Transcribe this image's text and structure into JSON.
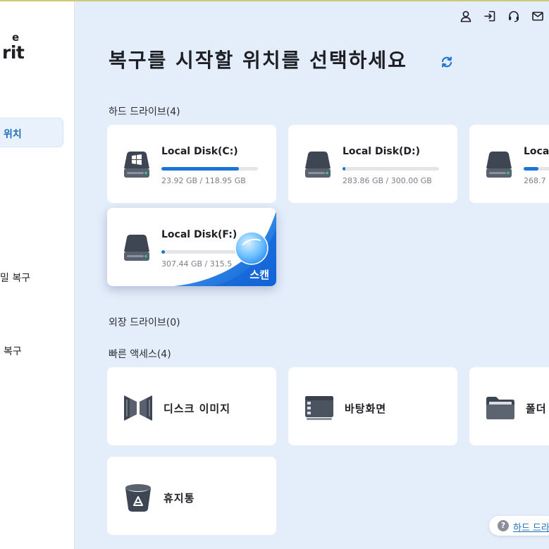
{
  "brand": {
    "logo_small": "e",
    "logo_large": "rit"
  },
  "sidebar": {
    "items": [
      {
        "label": "위치",
        "active": true
      },
      {
        "label": "밀 복구",
        "active": false
      },
      {
        "label": "복구",
        "active": false
      }
    ]
  },
  "topbar": {
    "icons": [
      "user-icon",
      "sign-in-icon",
      "headset-icon",
      "mail-icon"
    ]
  },
  "main": {
    "title": "복구를 시작할 위치를 선택하세요",
    "refresh_icon": "refresh-icon"
  },
  "hard_drives": {
    "label": "하드 드라이브(4)",
    "items": [
      {
        "name": "Local Disk(C:)",
        "size_text": "23.92 GB / 118.95 GB",
        "used_fraction": 0.8,
        "icon": "windows-disk-icon"
      },
      {
        "name": "Local Disk(D:)",
        "size_text": "283.86 GB / 300.00 GB",
        "used_fraction": 0.03,
        "icon": "disk-icon"
      },
      {
        "name": "Local",
        "size_text": "268.7",
        "used_fraction": 0.15,
        "icon": "disk-icon"
      },
      {
        "name": "Local Disk(F:)",
        "size_text": "307.44 GB / 315.5",
        "used_fraction": 0.04,
        "icon": "disk-icon",
        "scan_label": "스캔"
      }
    ]
  },
  "external_drives": {
    "label": "외장 드라이브(0)"
  },
  "quick_access": {
    "label": "빠른 액세스(4)",
    "items": [
      {
        "label": "디스크 이미지",
        "icon": "disk-image-icon"
      },
      {
        "label": "바탕화면",
        "icon": "desktop-icon"
      },
      {
        "label": "폴더",
        "icon": "folder-icon"
      },
      {
        "label": "휴지통",
        "icon": "trash-icon"
      }
    ]
  },
  "help": {
    "label": "하드 드라",
    "icon": "help-icon"
  },
  "colors": {
    "accent": "#1c74d4",
    "background": "#e4edfa",
    "card": "#ffffff"
  }
}
